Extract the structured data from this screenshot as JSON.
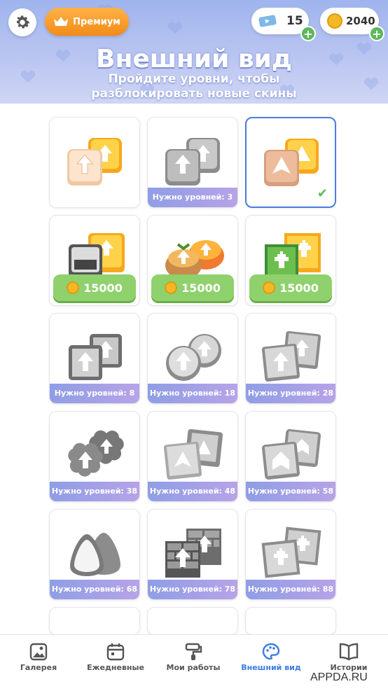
{
  "header": {
    "premium_label": "Премиум",
    "tickets_count": "15",
    "coins_count": "2040",
    "title": "Внешний вид",
    "subtitle": "Пройдите уровни, чтобы разблокировать новые скины"
  },
  "skins": [
    {
      "style": "classic",
      "state": "owned"
    },
    {
      "style": "classic",
      "state": "locked",
      "requirement": "Нужно уровней: 3"
    },
    {
      "style": "triangle",
      "state": "selected"
    },
    {
      "style": "truck",
      "state": "buy",
      "price": "15000"
    },
    {
      "style": "cake",
      "state": "buy",
      "price": "15000"
    },
    {
      "style": "pixel",
      "state": "buy",
      "price": "15000"
    },
    {
      "style": "frame",
      "state": "locked",
      "requirement": "Нужно уровней: 8"
    },
    {
      "style": "circle",
      "state": "locked",
      "requirement": "Нужно уровней: 18"
    },
    {
      "style": "square",
      "state": "locked",
      "requirement": "Нужно уровней: 28"
    },
    {
      "style": "cloud",
      "state": "locked",
      "requirement": "Нужно уровней: 38"
    },
    {
      "style": "triangle",
      "state": "locked",
      "requirement": "Нужно уровней: 48"
    },
    {
      "style": "chevron",
      "state": "locked",
      "requirement": "Нужно уровней: 58"
    },
    {
      "style": "drop",
      "state": "locked",
      "requirement": "Нужно уровней: 68"
    },
    {
      "style": "brick",
      "state": "locked",
      "requirement": "Нужно уровней: 78"
    },
    {
      "style": "pixel",
      "state": "locked",
      "requirement": "Нужно уровней: 88"
    }
  ],
  "tabs": [
    {
      "label": "Галерея",
      "icon": "gallery-icon"
    },
    {
      "label": "Ежедневные",
      "icon": "calendar-icon"
    },
    {
      "label": "Мои работы",
      "icon": "paint-roller-icon"
    },
    {
      "label": "Внешний вид",
      "icon": "palette-icon",
      "active": true
    },
    {
      "label": "Истории",
      "icon": "book-icon"
    }
  ],
  "watermark": "APPDA.RU",
  "colors": {
    "accent": "#3d7be3",
    "premium": "#f59a21",
    "buy_button": "#8fd16c",
    "locked_banner": "#9aa3e8"
  }
}
